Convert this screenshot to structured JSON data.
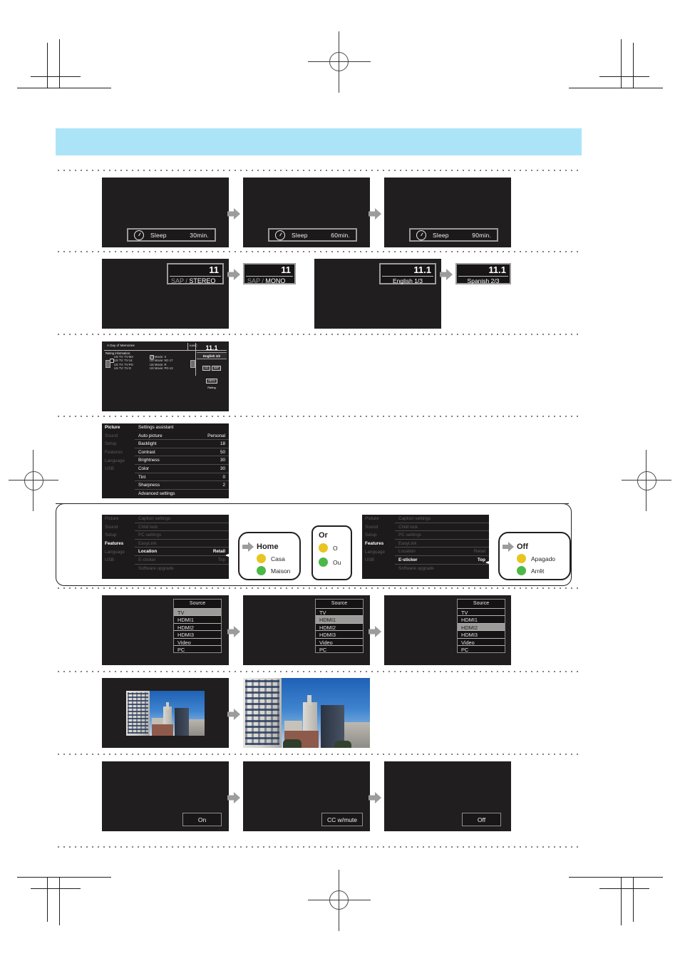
{
  "page": {
    "header_bar_color": "#ace4f7",
    "screen_color": "#201e1e"
  },
  "row_sleep": {
    "icon": "clock-icon",
    "screens": [
      {
        "label": "Sleep",
        "value": "30min."
      },
      {
        "label": "Sleep",
        "value": "60min."
      },
      {
        "label": "Sleep",
        "value": "90min."
      }
    ]
  },
  "row_audio": {
    "screens": [
      {
        "channel": "11",
        "mode_dim": "SAP /",
        "mode_on": "STEREO"
      },
      {
        "channel": "11",
        "mode_dim": "SAP /",
        "mode_on": "MONO"
      }
    ],
    "lang_screens": [
      {
        "channel": "11.1",
        "lang": "English 1/3"
      },
      {
        "channel": "11.1",
        "lang": "Spanish 2/3"
      }
    ]
  },
  "row_rating": {
    "program_title": "A Day of Memories",
    "station": "KABC",
    "section_label": "Rating information:",
    "rows": [
      {
        "tv": "US TV: TV-MA",
        "movie": "US Movie: X",
        "locked": true
      },
      {
        "tv": "US TV: TV-14",
        "movie": "US Movie: NC-17",
        "locked": false
      },
      {
        "tv": "US TV: TV-PG",
        "movie": "US Movie: R",
        "locked": false
      },
      {
        "tv": "US TV: TV-G",
        "movie": "US Movie: PG-13",
        "locked": false
      }
    ],
    "channel": "11.1",
    "language": "English 1/2",
    "pills": [
      "CC",
      "SAP",
      "HDTV"
    ],
    "rating_label": "Rating"
  },
  "row_picture": {
    "categories": [
      "Picture",
      "Sound",
      "Setup",
      "Features",
      "Language",
      "USB"
    ],
    "selected_category": "Picture",
    "items": [
      {
        "label": "Settings assistant",
        "value": ""
      },
      {
        "label": "Auto picture",
        "value": "Personal"
      },
      {
        "label": "Backlight",
        "value": "18"
      },
      {
        "label": "Contrast",
        "value": "50"
      },
      {
        "label": "Brightness",
        "value": "30"
      },
      {
        "label": "Color",
        "value": "30"
      },
      {
        "label": "Tint",
        "value": "0"
      },
      {
        "label": "Sharpness",
        "value": "2"
      },
      {
        "label": "Advanced settings",
        "value": ""
      }
    ]
  },
  "row_features": {
    "categories": [
      "Picture",
      "Sound",
      "Setup",
      "Features",
      "Language",
      "USB"
    ],
    "selected_category": "Features",
    "items": [
      {
        "label": "Caption settings",
        "value": ""
      },
      {
        "label": "Child lock",
        "value": ""
      },
      {
        "label": "PC settings",
        "value": ""
      },
      {
        "label": "EasyLink",
        "value": ""
      },
      {
        "label": "Location",
        "value": "Retail"
      },
      {
        "label": "E-sticker",
        "value": "Top"
      },
      {
        "label": "Software upgrade",
        "value": ""
      }
    ],
    "highlight_left": "Location",
    "highlight_left_value": "Retail",
    "highlight_right": "E-sticker",
    "highlight_right_value": "Top",
    "bubble_left": {
      "title": "Home",
      "options": [
        {
          "color": "#e8c520",
          "label": "Casa"
        },
        {
          "color": "#4cb848",
          "label": "Maison"
        }
      ]
    },
    "bubble_right": {
      "title": "Off",
      "options": [
        {
          "color": "#e8c520",
          "label": "Apagado"
        },
        {
          "color": "#4cb848",
          "label": "Arrêt"
        }
      ]
    },
    "or_box": {
      "title": "Or",
      "options": [
        {
          "color": "#ffffff",
          "label": "O"
        },
        {
          "color": "#4cb848",
          "label": "Ou"
        }
      ]
    }
  },
  "row_source": {
    "title": "Source",
    "items": [
      "TV",
      "HDMI1",
      "HDMI2",
      "HDMI3",
      "Video",
      "PC"
    ],
    "selected": [
      "TV",
      "HDMI1",
      "HDMI2"
    ]
  },
  "row_photo": {
    "caption": "city-skyline-photo"
  },
  "row_caption": {
    "screens": [
      "On",
      "CC w/mute",
      "Off"
    ]
  }
}
